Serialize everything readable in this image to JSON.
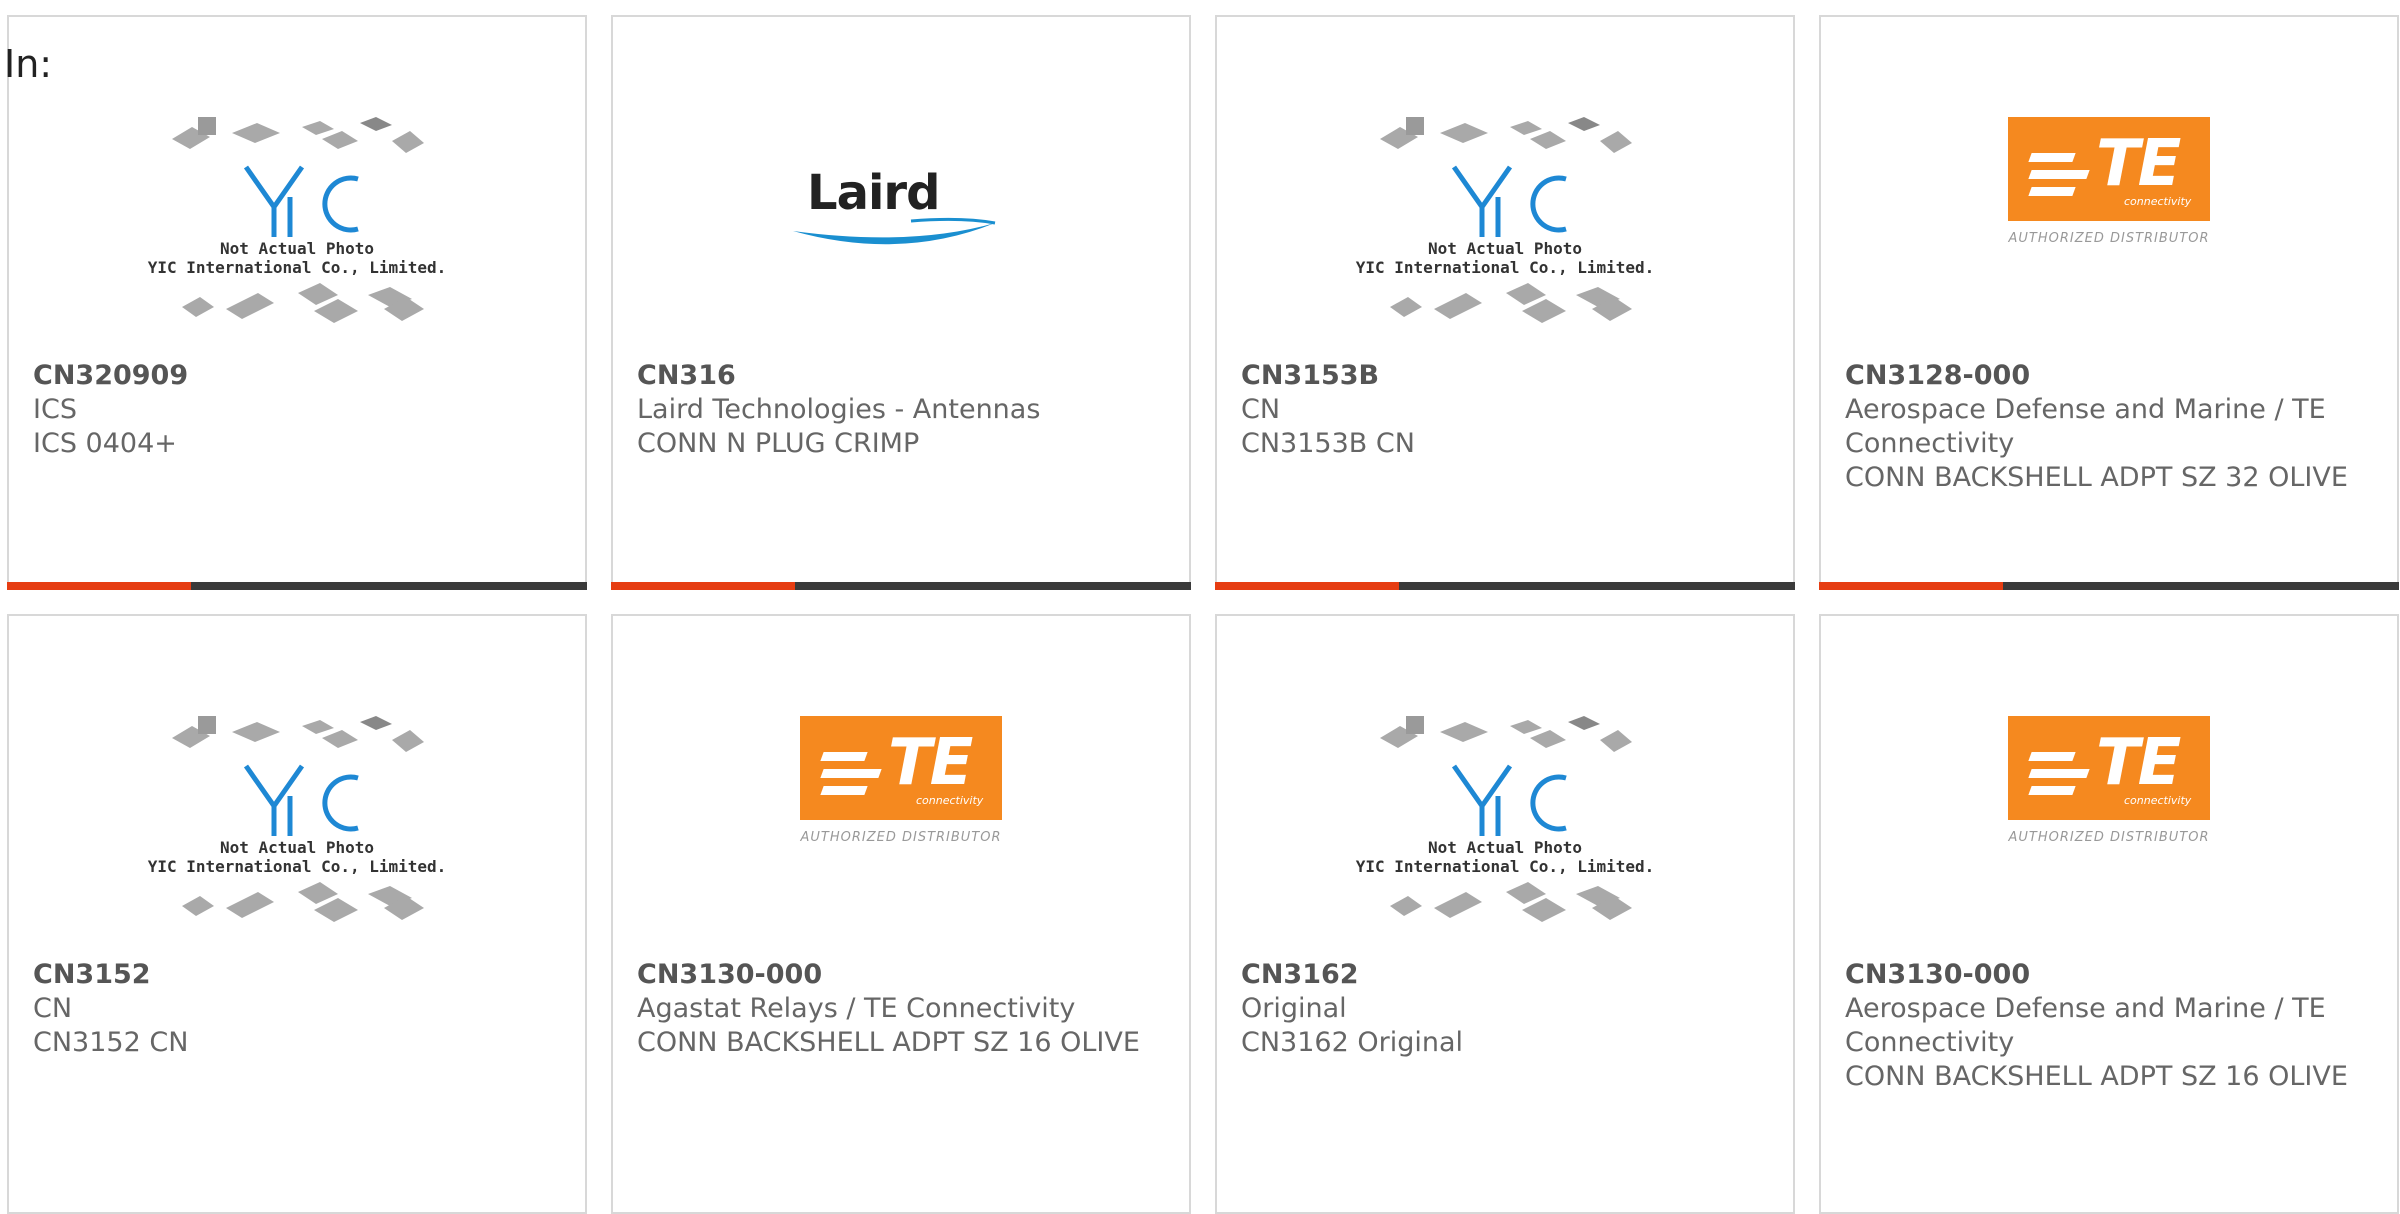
{
  "page": {
    "label": "In:"
  },
  "yic_caption": {
    "line1": "Not Actual Photo",
    "line2": "YIC International Co., Limited."
  },
  "te_logo": {
    "brand": "TE",
    "sub": "connectivity",
    "authorized": "AUTHORIZED DISTRIBUTOR"
  },
  "laird_logo": {
    "brand": "Laird"
  },
  "colors": {
    "accent": "#e63d12",
    "bar": "#3a3a3a",
    "te_orange": "#f5891f",
    "laird_blue": "#1a8fd0",
    "yic_blue": "#1e88d4"
  },
  "products": [
    {
      "part_number": "CN320909",
      "manufacturer": "ICS",
      "description": "ICS 0404+",
      "logo": "yic"
    },
    {
      "part_number": "CN316",
      "manufacturer": "Laird Technologies - Antennas",
      "description": "CONN N PLUG CRIMP",
      "logo": "laird"
    },
    {
      "part_number": "CN3153B",
      "manufacturer": "CN",
      "description": "CN3153B CN",
      "logo": "yic"
    },
    {
      "part_number": "CN3128-000",
      "manufacturer": "Aerospace Defense and Marine / TE Connectivity",
      "description": "CONN BACKSHELL ADPT SZ 32 OLIVE",
      "logo": "te"
    },
    {
      "part_number": "CN3152",
      "manufacturer": "CN",
      "description": "CN3152 CN",
      "logo": "yic"
    },
    {
      "part_number": "CN3130-000",
      "manufacturer": "Agastat Relays / TE Connectivity",
      "description": "CONN BACKSHELL ADPT SZ 16 OLIVE",
      "logo": "te"
    },
    {
      "part_number": "CN3162",
      "manufacturer": "Original",
      "description": "CN3162 Original",
      "logo": "yic"
    },
    {
      "part_number": "CN3130-000",
      "manufacturer": "Aerospace Defense and Marine / TE Connectivity",
      "description": "CONN BACKSHELL ADPT SZ 16 OLIVE",
      "logo": "te"
    }
  ]
}
